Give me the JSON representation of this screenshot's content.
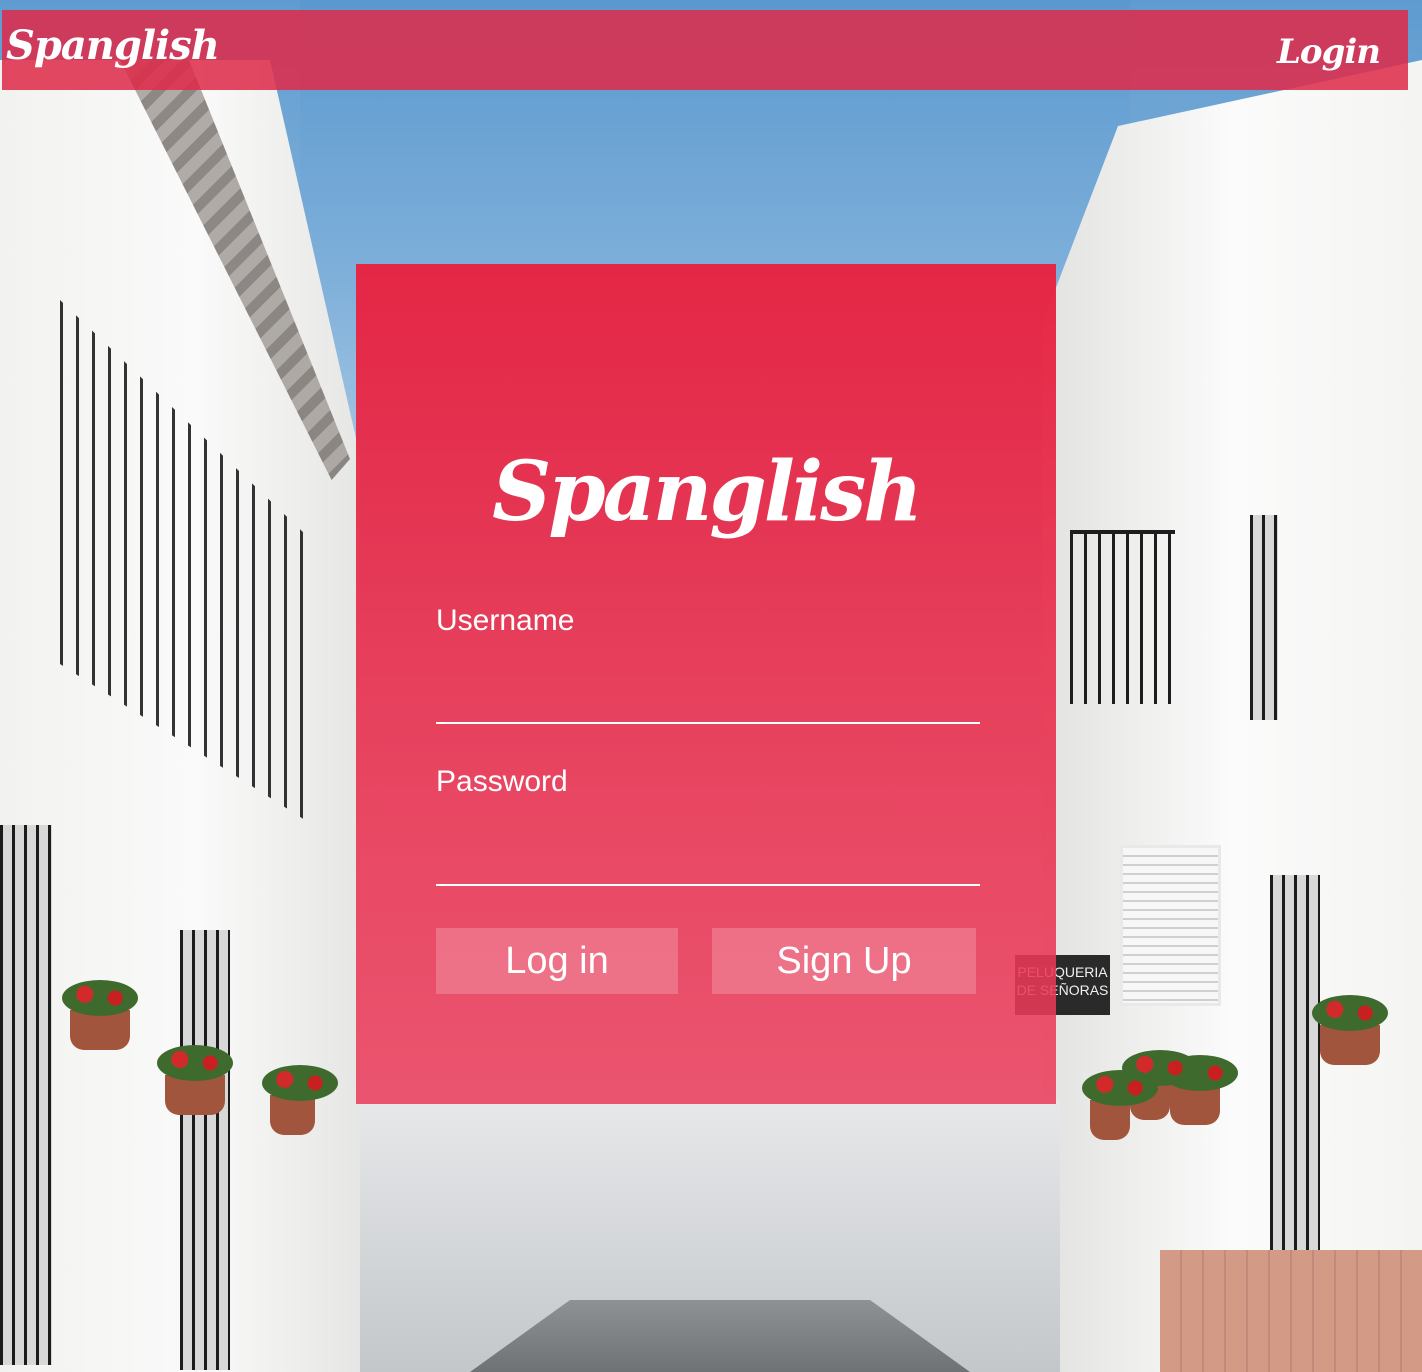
{
  "navbar": {
    "brand": "Spanglish",
    "login_link": "Login"
  },
  "login_card": {
    "logo": "Spanglish",
    "username_label": "Username",
    "username_value": "",
    "password_label": "Password",
    "password_value": "",
    "login_button": "Log in",
    "signup_button": "Sign Up"
  },
  "background": {
    "shop_sign": "PELUQUERIA DE SEÑORAS"
  },
  "colors": {
    "accent": "#e62a4a",
    "text": "#ffffff"
  }
}
